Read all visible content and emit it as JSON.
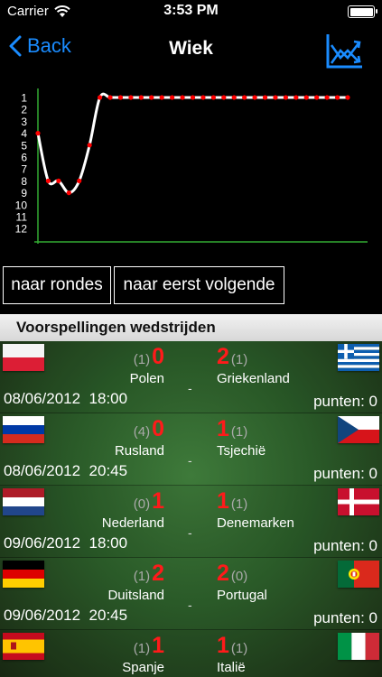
{
  "status_bar": {
    "carrier": "Carrier",
    "time": "3:53 PM"
  },
  "nav": {
    "back_label": "Back",
    "title": "Wiek",
    "chart_icon": "chart-toggle-icon"
  },
  "chart_data": {
    "type": "line",
    "x": [
      1,
      2,
      3,
      4,
      5,
      6,
      7,
      8,
      9,
      10,
      11,
      12,
      13,
      14,
      15,
      16,
      17,
      18,
      19,
      20,
      21,
      22,
      23,
      24,
      25,
      26,
      27,
      28,
      29,
      30,
      31
    ],
    "y": [
      4,
      8,
      8,
      9,
      8,
      5,
      1,
      1,
      1,
      1,
      1,
      1,
      1,
      1,
      1,
      1,
      1,
      1,
      1,
      1,
      1,
      1,
      1,
      1,
      1,
      1,
      1,
      1,
      1,
      1,
      1
    ],
    "y_ticks": [
      "1",
      "2",
      "3",
      "4",
      "5",
      "6",
      "7",
      "8",
      "9",
      "10",
      "11",
      "12"
    ],
    "ylim": [
      1,
      12
    ],
    "y_inverted": true,
    "line_color": "#ffffff",
    "marker_color": "#ff0000",
    "axis_color": "#33aa33"
  },
  "buttons": {
    "rondes": "naar rondes",
    "volgende": "naar eerst volgende"
  },
  "section": {
    "title": "Voorspellingen wedstrijden"
  },
  "dash": "-",
  "matches": [
    {
      "home_flag": "poland-flag",
      "away_flag": "greece-flag",
      "home_actual": "(1)",
      "home_pred": "0",
      "away_pred": "2",
      "away_actual": "(1)",
      "home": "Polen",
      "away": "Griekenland",
      "date": "08/06/2012",
      "time": "18:00",
      "points": "punten: 0"
    },
    {
      "home_flag": "russia-flag",
      "away_flag": "czech-flag",
      "home_actual": "(4)",
      "home_pred": "0",
      "away_pred": "1",
      "away_actual": "(1)",
      "home": "Rusland",
      "away": "Tsjechië",
      "date": "08/06/2012",
      "time": "20:45",
      "points": "punten: 0"
    },
    {
      "home_flag": "netherlands-flag",
      "away_flag": "denmark-flag",
      "home_actual": "(0)",
      "home_pred": "1",
      "away_pred": "1",
      "away_actual": "(1)",
      "home": "Nederland",
      "away": "Denemarken",
      "date": "09/06/2012",
      "time": "18:00",
      "points": "punten: 0"
    },
    {
      "home_flag": "germany-flag",
      "away_flag": "portugal-flag",
      "home_actual": "(1)",
      "home_pred": "2",
      "away_pred": "2",
      "away_actual": "(0)",
      "home": "Duitsland",
      "away": "Portugal",
      "date": "09/06/2012",
      "time": "20:45",
      "points": "punten: 0"
    },
    {
      "home_flag": "spain-flag",
      "away_flag": "italy-flag",
      "home_actual": "(1)",
      "home_pred": "1",
      "away_pred": "1",
      "away_actual": "(1)",
      "home": "Spanje",
      "away": "Italië",
      "date": "",
      "time": "",
      "points": ""
    }
  ]
}
